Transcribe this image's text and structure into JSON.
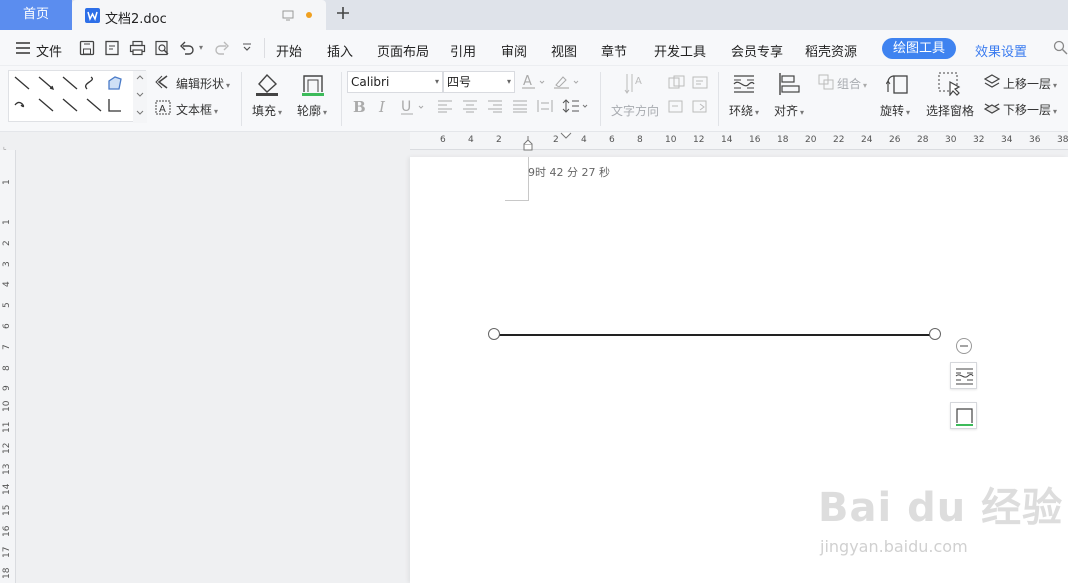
{
  "tabs": {
    "home_label": "首页",
    "doc_title": "文档2.doc"
  },
  "menu": {
    "file_label": "文件",
    "items": [
      "开始",
      "插入",
      "页面布局",
      "引用",
      "审阅",
      "视图",
      "章节",
      "开发工具",
      "会员专享",
      "稻壳资源",
      "绘图工具",
      "效果设置"
    ],
    "active_index": 10
  },
  "toolbar": {
    "edit_shape": "编辑形状",
    "text_box": "文本框",
    "fill": "填充",
    "outline": "轮廓",
    "font_name": "Calibri",
    "font_size": "四号",
    "text_direction": "文字方向",
    "wrap": "环绕",
    "align": "对齐",
    "group": "组合",
    "rotate": "旋转",
    "selection_pane": "选择窗格",
    "bring_forward": "上移一层",
    "send_backward": "下移一层"
  },
  "ruler": {
    "h_ticks": [
      "6",
      "4",
      "2",
      "2",
      "4",
      "6",
      "8",
      "10",
      "12",
      "14",
      "16",
      "18",
      "20",
      "22",
      "24",
      "26",
      "28",
      "30",
      "32",
      "34",
      "36",
      "38"
    ],
    "v_ticks": [
      "1",
      "1",
      "2",
      "3",
      "4",
      "5",
      "6",
      "7",
      "8",
      "9",
      "10",
      "11",
      "12",
      "13",
      "14",
      "15",
      "16",
      "17",
      "18"
    ]
  },
  "document": {
    "header_text": "9时 42 分 27 秒"
  },
  "watermark": {
    "brand": "Bai du 经验",
    "url": "jingyan.baidu.com"
  },
  "colors": {
    "accent": "#3a7bef",
    "home_tab": "#5b8def",
    "active_pill": "#3f83f0"
  }
}
